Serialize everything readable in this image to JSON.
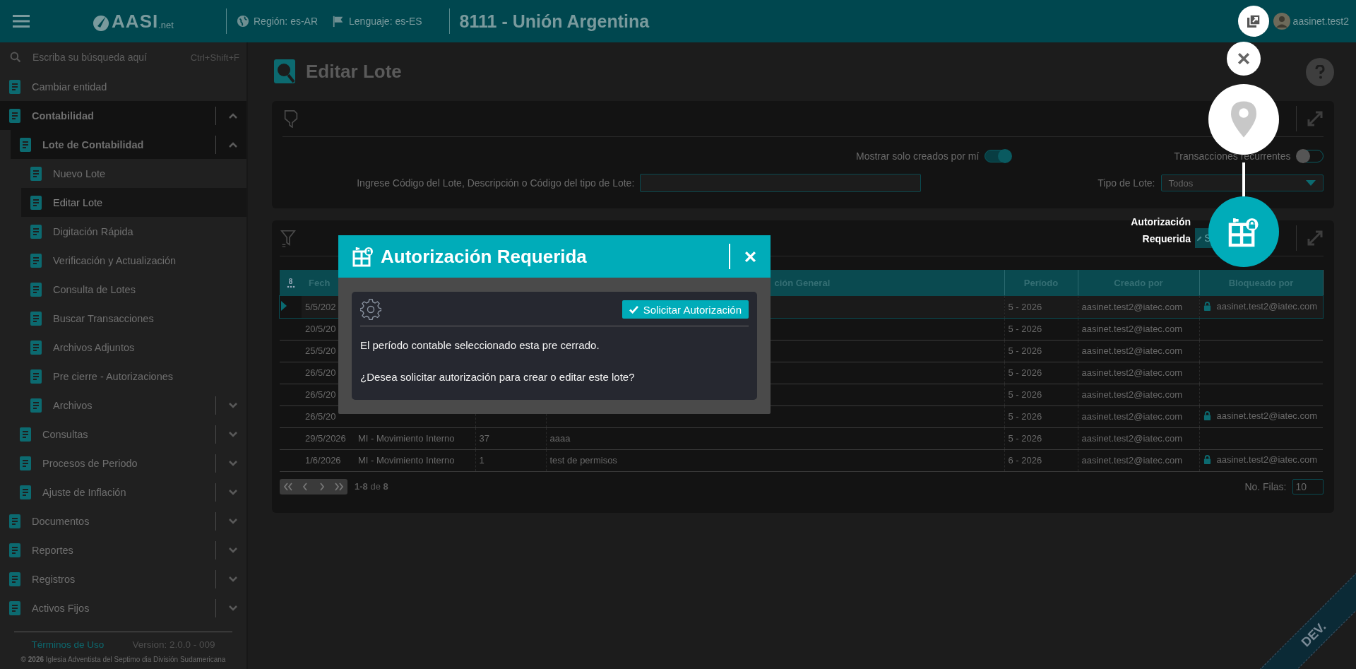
{
  "header": {
    "logo": {
      "text": "AASI",
      "suffix": ".net"
    },
    "region": "Región: es-AR",
    "language": "Lenguaje: es-ES",
    "entity": "8111 - Unión Argentina",
    "user": "aasinet.test2"
  },
  "sidebar": {
    "search": {
      "placeholder": "Escriba su búsqueda aquí",
      "shortcut": "Ctrl+Shift+F"
    },
    "items": [
      {
        "label": "Cambiar entidad",
        "kind": "link",
        "selected": false
      },
      {
        "label": "Contabilidad",
        "kind": "group",
        "expanded": true,
        "selected": false,
        "children": [
          {
            "label": "Lote de Contabilidad",
            "kind": "group",
            "expanded": true,
            "selected": false,
            "children": [
              {
                "label": "Nuevo Lote",
                "kind": "link",
                "selected": false
              },
              {
                "label": "Editar Lote",
                "kind": "link",
                "selected": true
              },
              {
                "label": "Digitación Rápida",
                "kind": "link",
                "selected": false
              },
              {
                "label": "Verificación y Actualización",
                "kind": "link",
                "selected": false
              },
              {
                "label": "Consulta de Lotes",
                "kind": "link",
                "selected": false
              },
              {
                "label": "Buscar Transacciones",
                "kind": "link",
                "selected": false
              },
              {
                "label": "Archivos Adjuntos",
                "kind": "link",
                "selected": false
              },
              {
                "label": "Pre cierre - Autorizaciones",
                "kind": "link",
                "selected": false
              },
              {
                "label": "Archivos",
                "kind": "group",
                "expanded": false,
                "selected": false
              }
            ]
          },
          {
            "label": "Consultas",
            "kind": "group",
            "expanded": false,
            "selected": false
          },
          {
            "label": "Procesos de Periodo",
            "kind": "group",
            "expanded": false,
            "selected": false
          },
          {
            "label": "Ajuste de Inflación",
            "kind": "group",
            "expanded": false,
            "selected": false
          }
        ]
      },
      {
        "label": "Documentos",
        "kind": "group",
        "expanded": false,
        "selected": false
      },
      {
        "label": "Reportes",
        "kind": "group",
        "expanded": false,
        "selected": false
      },
      {
        "label": "Registros",
        "kind": "group",
        "expanded": false,
        "selected": false
      },
      {
        "label": "Activos Fijos",
        "kind": "group",
        "expanded": false,
        "selected": false
      }
    ],
    "footer": {
      "terms": "Términos de Uso",
      "version": "Version: 2.0.0 - 009",
      "copyright": "**© 2026** Iglesia Adventista del Septimo dia División Sudamericana"
    }
  },
  "page": {
    "title": "Editar Lote"
  },
  "filters": {
    "created_by_me": {
      "label": "Mostrar solo creados por mí",
      "on": true
    },
    "recurring": {
      "label": "Transacciones recurrentes",
      "on": false
    },
    "search": {
      "label": "Ingrese Código del Lote, Descripción o Código del tipo de Lote:"
    },
    "batch_type": {
      "label": "Tipo de Lote:",
      "value": "Todos"
    }
  },
  "table": {
    "toolbar_button": {
      "label": "S"
    },
    "row_count": "8",
    "columns": {
      "date": "Fech",
      "description": "ción General",
      "period": "Período",
      "created_by": "Creado por",
      "locked_by": "Bloqueado por"
    },
    "rows": [
      {
        "date": "5/5/202",
        "period": "5 - 2026",
        "created_by": "aasinet.test2@iatec.com",
        "locked_by": "aasinet.test2@iatec.com",
        "selected": true
      },
      {
        "date": "20/5/20",
        "period": "5 - 2026",
        "created_by": "aasinet.test2@iatec.com",
        "selected": false
      },
      {
        "date": "25/5/20",
        "period": "5 - 2026",
        "created_by": "aasinet.test2@iatec.com",
        "selected": false
      },
      {
        "date": "26/5/20",
        "period": "5 - 2026",
        "created_by": "aasinet.test2@iatec.com",
        "selected": false
      },
      {
        "date": "26/5/20",
        "period": "5 - 2026",
        "created_by": "aasinet.test2@iatec.com",
        "selected": false
      },
      {
        "date": "26/5/20",
        "period": "5 - 2026",
        "created_by": "aasinet.test2@iatec.com",
        "locked_by": "aasinet.test2@iatec.com",
        "selected": false
      },
      {
        "date": "29/5/2026",
        "type": "MI - Movimiento Interno",
        "number": "37",
        "description": "aaaa",
        "period": "5 - 2026",
        "created_by": "aasinet.test2@iatec.com",
        "selected": false
      },
      {
        "date": "1/6/2026",
        "type": "MI - Movimiento Interno",
        "number": "1",
        "description": "test de permisos",
        "period": "6 - 2026",
        "created_by": "aasinet.test2@iatec.com",
        "locked_by": "aasinet.test2@iatec.com",
        "selected": false
      }
    ],
    "pager": {
      "range": "**1-8** de **8**",
      "rows_label": "No. Filas:",
      "rows_value": "10"
    }
  },
  "modal": {
    "title": "Autorización Requerida",
    "action": "Solicitar Autorización",
    "paragraphs": [
      "El período contable seleccionado esta pre cerrado.",
      "¿Desea solicitar autorización para crear o editar este lote?"
    ]
  },
  "tour": {
    "label": "Autorización Requerida"
  },
  "env_ribbon": {
    "label": "DEV."
  }
}
